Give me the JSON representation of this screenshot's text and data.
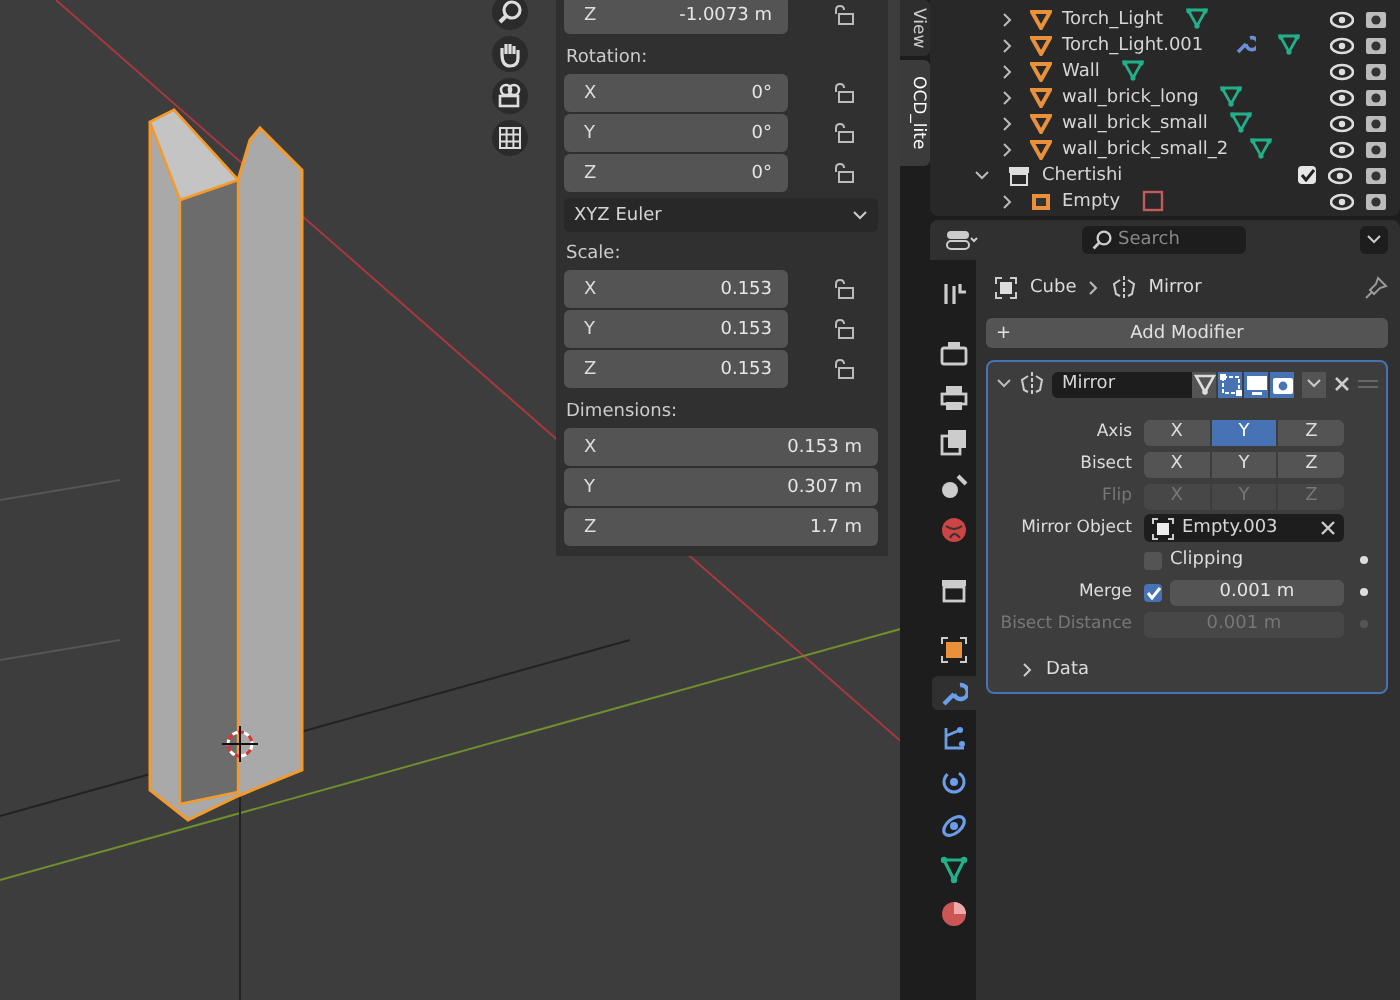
{
  "transform_panel": {
    "location": {
      "fields": [
        {
          "label": "Z",
          "value": "-1.0073 m"
        }
      ]
    },
    "rotation": {
      "title": "Rotation:",
      "fields": [
        {
          "label": "X",
          "value": "0°"
        },
        {
          "label": "Y",
          "value": "0°"
        },
        {
          "label": "Z",
          "value": "0°"
        }
      ]
    },
    "rotation_mode": "XYZ Euler",
    "scale": {
      "title": "Scale:",
      "fields": [
        {
          "label": "X",
          "value": "0.153"
        },
        {
          "label": "Y",
          "value": "0.153"
        },
        {
          "label": "Z",
          "value": "0.153"
        }
      ]
    },
    "dimensions": {
      "title": "Dimensions:",
      "fields": [
        {
          "label": "X",
          "value": "0.153 m"
        },
        {
          "label": "Y",
          "value": "0.307 m"
        },
        {
          "label": "Z",
          "value": "1.7 m"
        }
      ]
    }
  },
  "sidebar_tabs": [
    {
      "label": "View",
      "selected": false
    },
    {
      "label": "OCD_lite",
      "selected": true
    }
  ],
  "outliner": {
    "rows": [
      {
        "kind": "object",
        "name": "Torch_Light",
        "has_modifier": false
      },
      {
        "kind": "object",
        "name": "Torch_Light.001",
        "has_modifier": true
      },
      {
        "kind": "object",
        "name": "Wall",
        "has_modifier": false
      },
      {
        "kind": "object",
        "name": "wall_brick_long",
        "has_modifier": false
      },
      {
        "kind": "object",
        "name": "wall_brick_small",
        "has_modifier": false
      },
      {
        "kind": "object",
        "name": "wall_brick_small_2",
        "has_modifier": false
      },
      {
        "kind": "collection",
        "name": "Chertishi",
        "checked": true
      },
      {
        "kind": "empty",
        "name": "Empty",
        "has_modifier": false
      }
    ]
  },
  "properties": {
    "search": {
      "placeholder": "Search"
    },
    "tabs": [
      {
        "selected": false
      },
      {
        "selected": false
      },
      {
        "selected": false
      },
      {
        "selected": false
      },
      {
        "selected": false
      },
      {
        "selected": false
      },
      {
        "selected": false
      },
      {
        "selected": false
      },
      {
        "selected": true
      },
      {
        "selected": false
      },
      {
        "selected": false
      },
      {
        "selected": false
      },
      {
        "selected": false
      },
      {
        "selected": false
      }
    ],
    "breadcrumb": [
      "Cube",
      "Mirror"
    ],
    "add_modifier": {
      "icon": "+",
      "label": "Add Modifier"
    },
    "modifier": {
      "name": "Mirror",
      "toggles": [
        {
          "on": false
        },
        {
          "on": true
        },
        {
          "on": true
        },
        {
          "on": true
        }
      ],
      "rows": [
        {
          "kind": "axes",
          "label": "Axis",
          "disabled": false,
          "buttons": [
            {
              "label": "X",
              "selected": false
            },
            {
              "label": "Y",
              "selected": true
            },
            {
              "label": "Z",
              "selected": false
            }
          ]
        },
        {
          "kind": "axes",
          "label": "Bisect",
          "disabled": false,
          "buttons": [
            {
              "label": "X",
              "selected": false
            },
            {
              "label": "Y",
              "selected": false
            },
            {
              "label": "Z",
              "selected": false
            }
          ]
        },
        {
          "kind": "axes",
          "label": "Flip",
          "disabled": true,
          "buttons": [
            {
              "label": "X",
              "selected": false
            },
            {
              "label": "Y",
              "selected": false
            },
            {
              "label": "Z",
              "selected": false
            }
          ]
        },
        {
          "kind": "object",
          "label": "Mirror Object",
          "value": "Empty.003"
        },
        {
          "kind": "check",
          "label": "Clipping",
          "checked": false
        },
        {
          "kind": "merge",
          "label": "Merge",
          "checked": true,
          "value": "0.001 m"
        },
        {
          "kind": "number",
          "label": "Bisect Distance",
          "value": "0.001 m",
          "disabled": true
        }
      ],
      "subpanel": {
        "label": "Data",
        "expanded": false
      }
    }
  }
}
